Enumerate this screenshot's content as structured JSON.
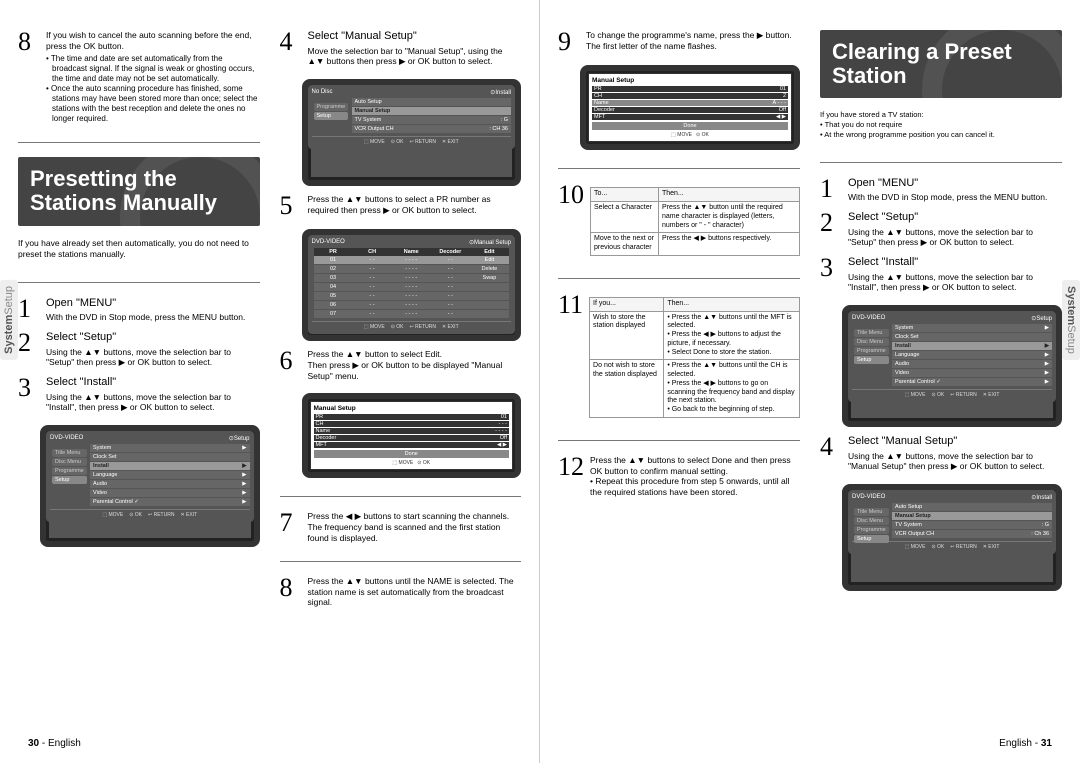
{
  "side_tab": {
    "system": "System",
    "setup": "Setup"
  },
  "page_left_num": {
    "num": "30",
    "sep": " - ",
    "lang": "English"
  },
  "page_right_num": {
    "lang": "English",
    "sep": " - ",
    "num": "31"
  },
  "heading_presetting": "Presetting the Stations Manually",
  "heading_clearing": "Clearing a Preset Station",
  "presetting_intro": "If you have already set then automatically, you do not need to preset the stations manually.",
  "clearing_intro_lines": [
    "If you have stored a TV station:",
    "• That you do not require",
    "• At the wrong programme position you can cancel it."
  ],
  "steps_left_a": {
    "8": {
      "text": "If you wish to cancel the auto scanning before the end, press the OK button.",
      "bullets": [
        "• The time and date are set automatically from the broadcast signal. If the signal is weak or ghosting occurs, the time and date may not be set automatically.",
        "• Once the auto scanning procedure has finished, some stations may have been stored more than once; select the stations with the best reception and delete the ones no longer required."
      ]
    },
    "1": {
      "title": "Open \"MENU\"",
      "text": "With the DVD in Stop mode, press the MENU button."
    },
    "2": {
      "title": "Select \"Setup\"",
      "text": "Using the ▲▼ buttons, move the selection bar to \"Setup\" then press ▶ or OK button to select."
    },
    "3": {
      "title": "Select \"Install\"",
      "text": "Using the ▲▼ buttons, move the selection bar to \"Install\", then press ▶ or OK button to select."
    }
  },
  "steps_left_b": {
    "4": {
      "title": "Select \"Manual Setup\"",
      "text": "Move the selection bar to \"Manual Setup\", using the ▲▼ buttons then press ▶ or OK button to select."
    },
    "5": {
      "text": "Press the ▲▼ buttons to select a PR number as required then press ▶ or OK button to select."
    },
    "6": {
      "text": "Press the ▲▼ button to select Edit.\nThen press ▶ or OK button to be displayed \"Manual Setup\" menu."
    },
    "7": {
      "text": "Press the ◀ ▶ buttons to start scanning the channels.\nThe frequency band is scanned and the first station found is displayed."
    },
    "8": {
      "text": "Press the ▲▼ buttons until the NAME is selected. The station name is set automatically from the broadcast signal."
    }
  },
  "steps_right_a": {
    "9": {
      "text": "To change the programme's name, press the ▶ button. The first letter of the name flashes."
    },
    "10_table": {
      "headers": [
        "To...",
        "Then..."
      ],
      "rows": [
        [
          "Select a Character",
          "Press the ▲▼ button until the required name character is displayed (letters, numbers or \" - \" character)"
        ],
        [
          "Move to the next or previous character",
          "Press the ◀ ▶ buttons respectively."
        ]
      ]
    },
    "11_table": {
      "headers": [
        "If you...",
        "Then..."
      ],
      "rows": [
        [
          "Wish to store the station displayed",
          "• Press the ▲▼ buttons until the MFT is selected.\n• Press the ◀ ▶ buttons to adjust the picture, if necessary.\n• Select Done to store the station."
        ],
        [
          "Do not wish to store the station displayed",
          "• Press the ▲▼ buttons until the CH is selected.\n• Press the ◀ ▶ buttons to go on scanning the frequency band and display the next station.\n• Go back to the beginning of step."
        ]
      ]
    },
    "12": {
      "text": "Press the ▲▼ buttons to select Done and then press OK button to confirm manual setting.\n• Repeat this procedure from step 5 onwards, until all the required stations have been stored."
    }
  },
  "steps_right_b": {
    "1": {
      "title": "Open \"MENU\"",
      "text": "With the DVD in Stop mode, press the MENU button."
    },
    "2": {
      "title": "Select \"Setup\"",
      "text": "Using the ▲▼ buttons, move the selection bar to \"Setup\" then press ▶ or OK button to select."
    },
    "3": {
      "title": "Select \"Install\"",
      "text": "Using the ▲▼ buttons, move the selection bar to \"Install\", then press ▶ or OK button to select."
    },
    "4": {
      "title": "Select \"Manual Setup\"",
      "text": "Using the ▲▼ buttons, move the selection bar to \"Manual Setup\" then press ▶ or OK button to select."
    }
  },
  "tv": {
    "no_disc": "No Disc",
    "install": "Install",
    "setup": "Setup",
    "dvd_video": "DVD-VIDEO",
    "manual_setup": "Manual Setup",
    "tabs": [
      "Title Menu",
      "Disc Menu",
      "Programme",
      "Setup"
    ],
    "menu1_items": [
      [
        "Auto Setup",
        ""
      ],
      [
        "Manual Setup",
        ""
      ],
      [
        "TV System",
        ": G"
      ],
      [
        "VCR Output CH",
        ": CH 36"
      ]
    ],
    "menu2_items": [
      [
        "System",
        "▶"
      ],
      [
        "Clock Set",
        ""
      ],
      [
        "Install",
        "▶"
      ],
      [
        "Language",
        "▶"
      ],
      [
        "Audio",
        "▶"
      ],
      [
        "Video",
        "▶"
      ],
      [
        "Parental Control ✓",
        "▶"
      ]
    ],
    "grid_headers": [
      "PR",
      "CH",
      "Name",
      "Decoder",
      "Edit"
    ],
    "grid_rows": [
      [
        "01",
        "- -",
        "- - - -",
        "- -",
        "Edit"
      ],
      [
        "02",
        "- -",
        "- - - -",
        "- -",
        "Delete"
      ],
      [
        "03",
        "- -",
        "- - - -",
        "- -",
        "Swap"
      ],
      [
        "04",
        "- -",
        "- - - -",
        "- -",
        ""
      ],
      [
        "05",
        "- -",
        "- - - -",
        "- -",
        ""
      ],
      [
        "06",
        "- -",
        "- - - -",
        "- -",
        ""
      ],
      [
        "07",
        "- -",
        "- - - -",
        "- -",
        ""
      ]
    ],
    "ms_rows": [
      [
        "PR",
        "01"
      ],
      [
        "CH",
        "- - -"
      ],
      [
        "Name",
        "- - - -"
      ],
      [
        "Decoder",
        "Off"
      ],
      [
        "MFT",
        "◀  ▶"
      ]
    ],
    "ms_rows_9": [
      [
        "PR",
        "01"
      ],
      [
        "CH",
        "2"
      ],
      [
        "Name",
        "A - - -"
      ],
      [
        "Decoder",
        "Off"
      ],
      [
        "MFT",
        "◀  ▶"
      ]
    ],
    "done": "Done",
    "footer": [
      "⬚ MOVE",
      "⊙ OK",
      "↩ RETURN",
      "✕ EXIT"
    ],
    "footer_short": [
      "⬚ MOVE",
      "⊙ OK"
    ]
  }
}
